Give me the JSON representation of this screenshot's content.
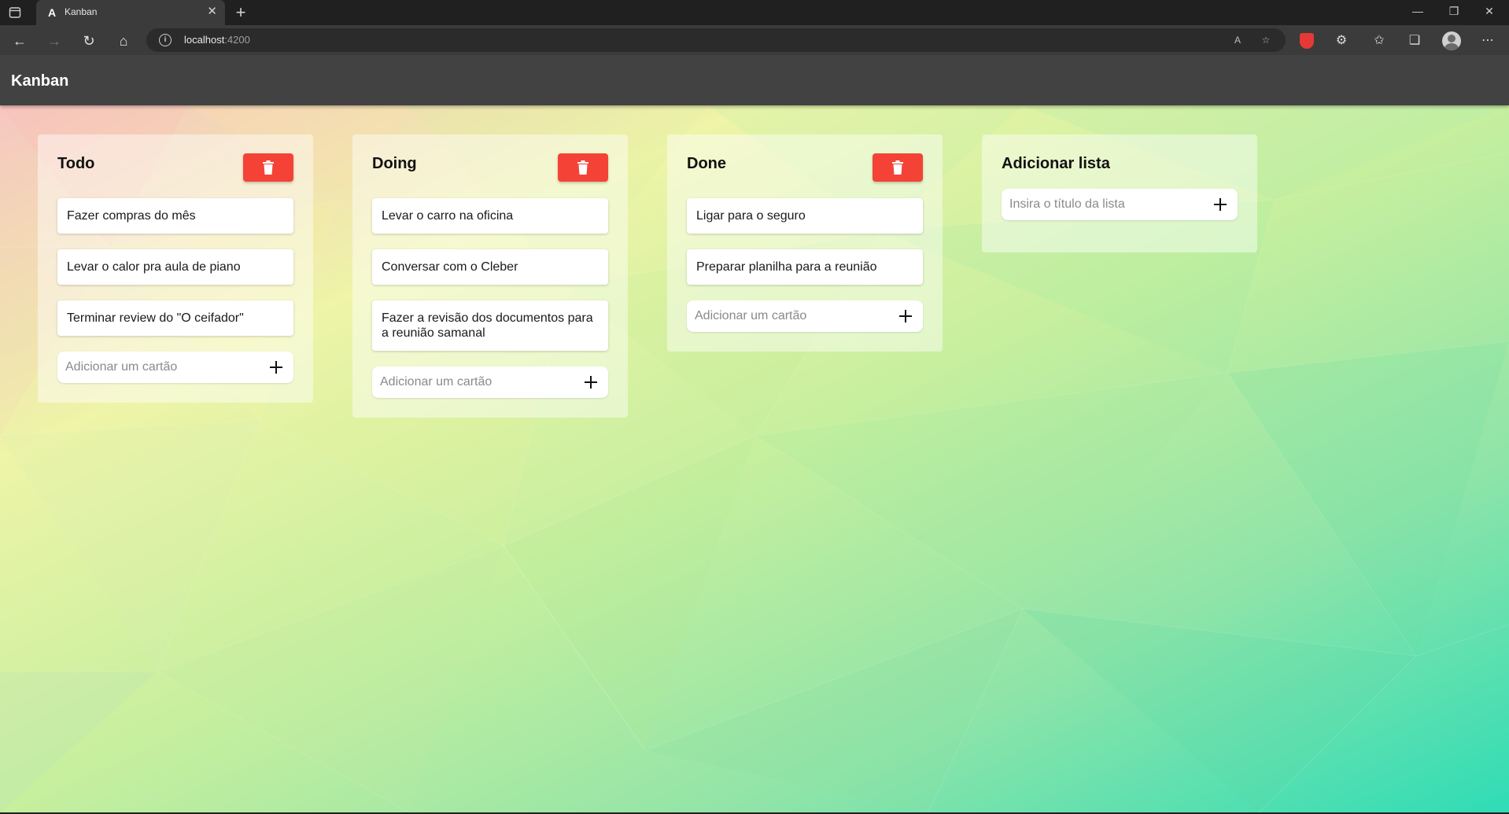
{
  "browser": {
    "tab_title": "Kanban",
    "tab_favicon": "A",
    "url_host": "localhost",
    "url_port": ":4200",
    "icons": [
      "sidebar-icon",
      "close-icon",
      "new-tab-icon",
      "minimize-icon",
      "restore-icon",
      "window-close-icon",
      "back-icon",
      "forward-icon",
      "refresh-icon",
      "home-icon",
      "info-icon",
      "read-aloud-icon",
      "add-favorite-icon",
      "adblock-icon",
      "extensions-icon",
      "favorites-icon",
      "collections-icon",
      "profile-icon",
      "more-icon"
    ]
  },
  "app": {
    "title": "Kanban"
  },
  "lists": [
    {
      "title": "Todo",
      "cards": [
        "Fazer compras do mês",
        "Levar o calor pra aula de piano",
        "Terminar review do \"O ceifador\""
      ],
      "add_card_placeholder": "Adicionar um cartão"
    },
    {
      "title": "Doing",
      "cards": [
        "Levar o carro na oficina",
        "Conversar com o Cleber",
        "Fazer a revisão dos documentos para a reunião samanal"
      ],
      "add_card_placeholder": "Adicionar um cartão"
    },
    {
      "title": "Done",
      "cards": [
        "Ligar para o seguro",
        "Preparar planilha para a reunião"
      ],
      "add_card_placeholder": "Adicionar um cartão"
    }
  ],
  "add_list": {
    "title": "Adicionar lista",
    "placeholder": "Insira o título da lista"
  },
  "colors": {
    "toolbar": "#424242",
    "delete_button": "#f44336",
    "background_top_left": "#f6c6c0",
    "background_center": "#cdf19c",
    "background_bottom_right": "#2fdcb6"
  }
}
